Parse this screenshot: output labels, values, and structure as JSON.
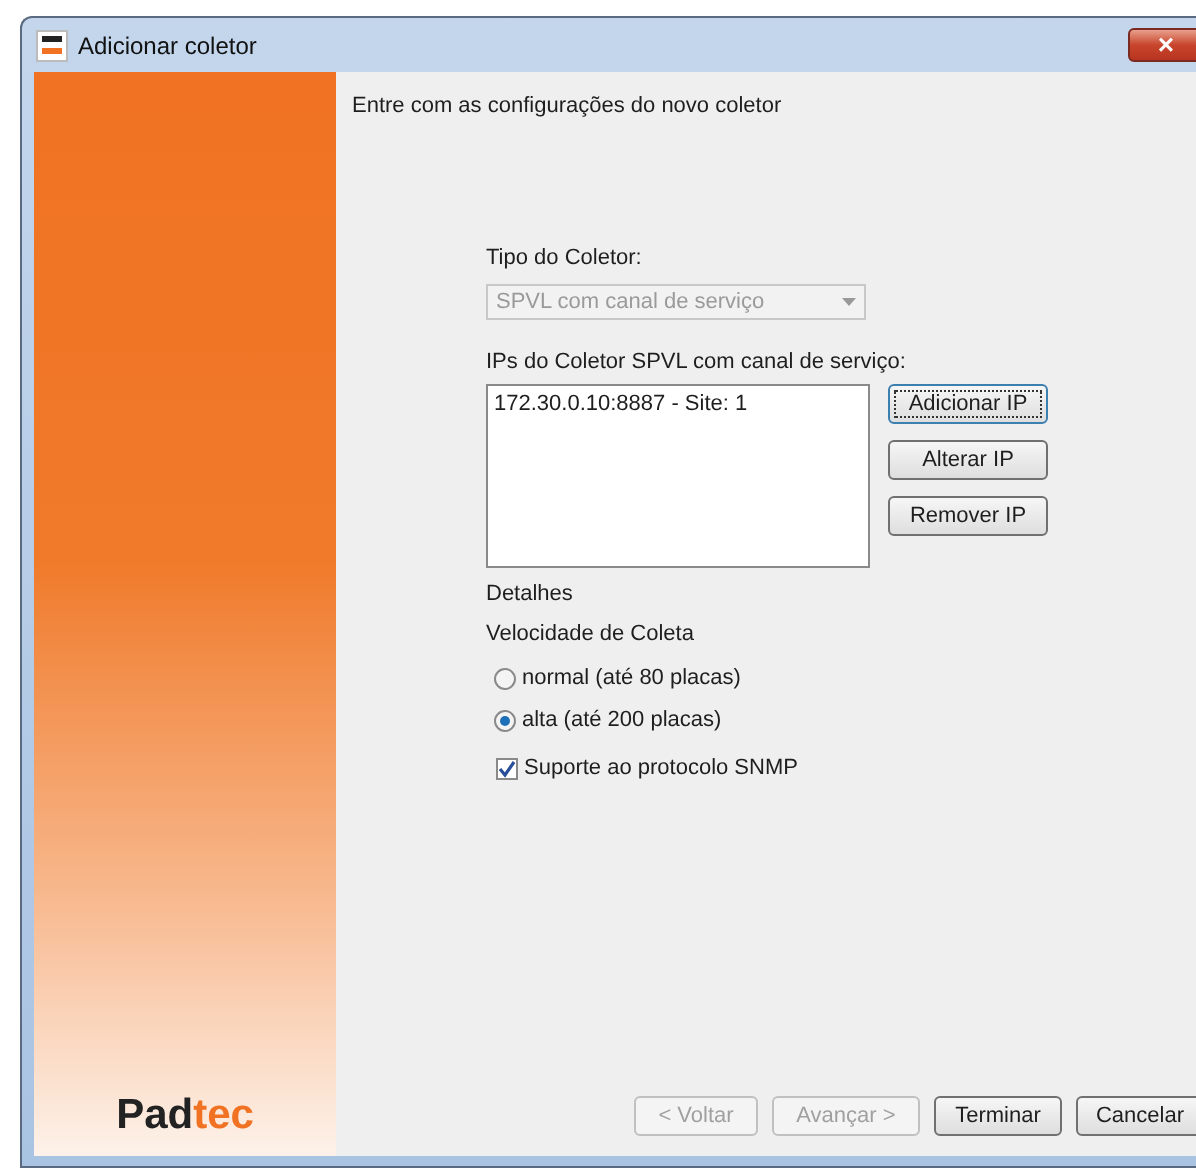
{
  "window": {
    "title": "Adicionar coletor",
    "close": "×"
  },
  "sidebar": {
    "logo_part_1": "Pad",
    "logo_part_2": "tec"
  },
  "intro": "Entre com as configurações do novo coletor",
  "collector_type": {
    "label": "Tipo do Coletor:",
    "value": "SPVL com canal de serviço",
    "disabled": true
  },
  "ip_list": {
    "label": "IPs do Coletor SPVL com canal de serviço:",
    "items": [
      {
        "text": "172.30.0.10:8887 - Site: 1",
        "selected": false
      }
    ]
  },
  "ip_buttons": [
    {
      "label": "Adicionar IP",
      "focused": true
    },
    {
      "label": "Alterar IP",
      "focused": false
    },
    {
      "label": "Remover IP",
      "focused": false
    }
  ],
  "details_label": "Detalhes",
  "speed": {
    "label": "Velocidade de Coleta",
    "options": [
      {
        "label": "normal (até 80 placas)",
        "selected": false
      },
      {
        "label": "alta (até 200 placas)",
        "selected": true
      }
    ]
  },
  "snmp": {
    "label": "Suporte ao protocolo SNMP",
    "checked": true
  },
  "footer_buttons": [
    {
      "label": "< Voltar",
      "disabled": true
    },
    {
      "label": "Avançar >",
      "disabled": true
    },
    {
      "label": "Terminar",
      "disabled": false
    },
    {
      "label": "Cancelar",
      "disabled": false
    }
  ]
}
